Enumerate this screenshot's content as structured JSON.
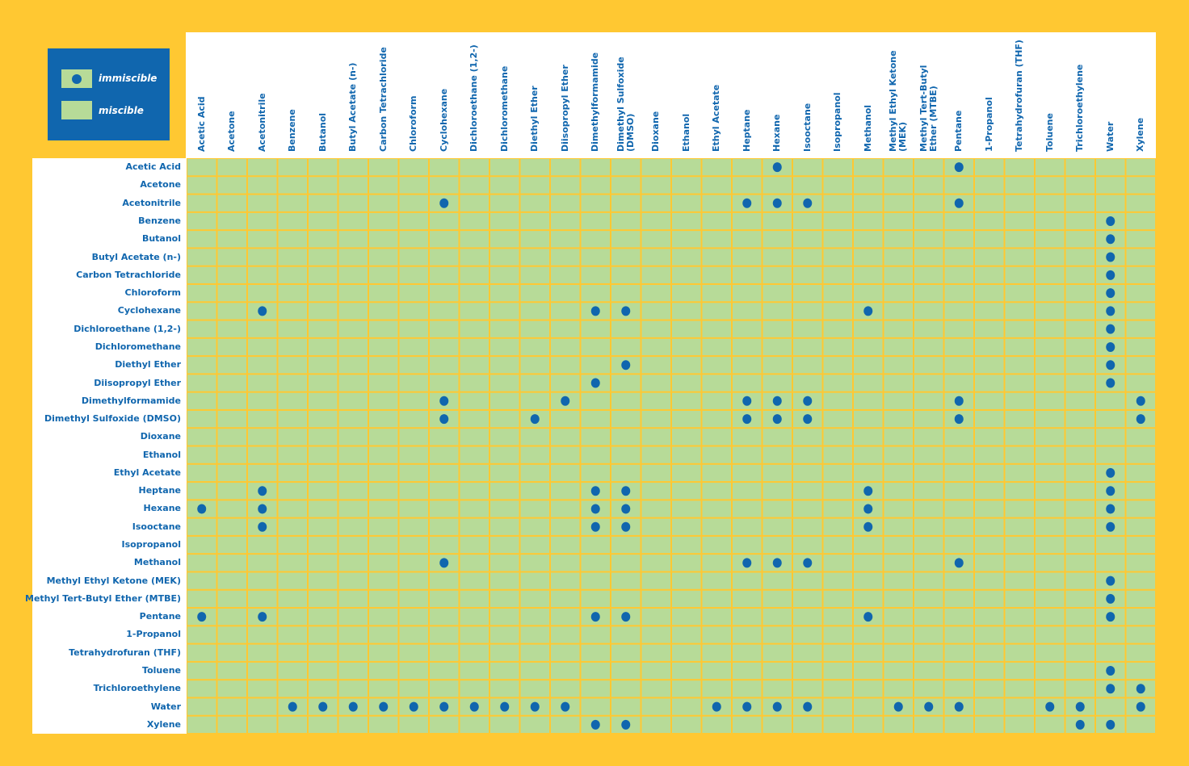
{
  "chart_data": {
    "type": "heatmap",
    "title": "",
    "legend": {
      "placement": "top-left",
      "entries": [
        {
          "label": "immiscible",
          "marker": "dot"
        },
        {
          "label": "miscible",
          "marker": "blank"
        }
      ]
    },
    "colors": {
      "background": "#FFC832",
      "cell": "#B7DB98",
      "dot": "#1066AE",
      "label_text": "#1066AE",
      "legend_box": "#1066AE"
    },
    "columns": [
      "Acetic Acid",
      "Acetone",
      "Acetonitrile",
      "Benzene",
      "Butanol",
      "Butyl Acetate (n-)",
      "Carbon Tetrachloride",
      "Chloroform",
      "Cyclohexane",
      "Dichloroethane (1,2-)",
      "Dichloromethane",
      "Diethyl Ether",
      "Diisopropyl Ether",
      "Dimethylformamide",
      "Dimethyl Sulfoxide\n(DMSO)",
      "Dioxane",
      "Ethanol",
      "Ethyl Acetate",
      "Heptane",
      "Hexane",
      "Isooctane",
      "Isopropanol",
      "Methanol",
      "Methyl Ethyl Ketone\n(MEK)",
      "Methyl Tert-Butyl\nEther (MTBE)",
      "Pentane",
      "1-Propanol",
      "Tetrahydrofuran (THF)",
      "Toluene",
      "Trichloroethylene",
      "Water",
      "Xylene"
    ],
    "rows": [
      {
        "label": "Acetic Acid",
        "immiscible": [
          19,
          25
        ]
      },
      {
        "label": "Acetone",
        "immiscible": []
      },
      {
        "label": "Acetonitrile",
        "immiscible": [
          8,
          18,
          19,
          20,
          25
        ]
      },
      {
        "label": "Benzene",
        "immiscible": [
          30
        ]
      },
      {
        "label": "Butanol",
        "immiscible": [
          30
        ]
      },
      {
        "label": "Butyl Acetate (n-)",
        "immiscible": [
          30
        ]
      },
      {
        "label": "Carbon Tetrachloride",
        "immiscible": [
          30
        ]
      },
      {
        "label": "Chloroform",
        "immiscible": [
          30
        ]
      },
      {
        "label": "Cyclohexane",
        "immiscible": [
          2,
          13,
          14,
          22,
          30
        ]
      },
      {
        "label": "Dichloroethane (1,2-)",
        "immiscible": [
          30
        ]
      },
      {
        "label": "Dichloromethane",
        "immiscible": [
          30
        ]
      },
      {
        "label": "Diethyl Ether",
        "immiscible": [
          14,
          30
        ]
      },
      {
        "label": "Diisopropyl Ether",
        "immiscible": [
          13,
          30
        ]
      },
      {
        "label": "Dimethylformamide",
        "immiscible": [
          8,
          12,
          18,
          19,
          20,
          25,
          31
        ]
      },
      {
        "label": "Dimethyl Sulfoxide (DMSO)",
        "immiscible": [
          8,
          11,
          18,
          19,
          20,
          25,
          31
        ]
      },
      {
        "label": "Dioxane",
        "immiscible": []
      },
      {
        "label": "Ethanol",
        "immiscible": []
      },
      {
        "label": "Ethyl Acetate",
        "immiscible": [
          30
        ]
      },
      {
        "label": "Heptane",
        "immiscible": [
          2,
          13,
          14,
          22,
          30
        ]
      },
      {
        "label": "Hexane",
        "immiscible": [
          0,
          2,
          13,
          14,
          22,
          30
        ]
      },
      {
        "label": "Isooctane",
        "immiscible": [
          2,
          13,
          14,
          22,
          30
        ]
      },
      {
        "label": "Isopropanol",
        "immiscible": []
      },
      {
        "label": "Methanol",
        "immiscible": [
          8,
          18,
          19,
          20,
          25
        ]
      },
      {
        "label": "Methyl Ethyl Ketone (MEK)",
        "immiscible": [
          30
        ]
      },
      {
        "label": "Methyl Tert-Butyl Ether (MTBE)",
        "immiscible": [
          30
        ]
      },
      {
        "label": "Pentane",
        "immiscible": [
          0,
          2,
          13,
          14,
          22,
          30
        ]
      },
      {
        "label": "1-Propanol",
        "immiscible": []
      },
      {
        "label": "Tetrahydrofuran (THF)",
        "immiscible": []
      },
      {
        "label": "Toluene",
        "immiscible": [
          30
        ]
      },
      {
        "label": "Trichloroethylene",
        "immiscible": [
          30,
          31
        ]
      },
      {
        "label": "Water",
        "immiscible": [
          3,
          4,
          5,
          6,
          7,
          8,
          9,
          10,
          11,
          12,
          17,
          18,
          19,
          20,
          23,
          24,
          25,
          28,
          29,
          31
        ]
      },
      {
        "label": "Xylene",
        "immiscible": [
          13,
          14,
          29,
          30
        ]
      }
    ]
  }
}
